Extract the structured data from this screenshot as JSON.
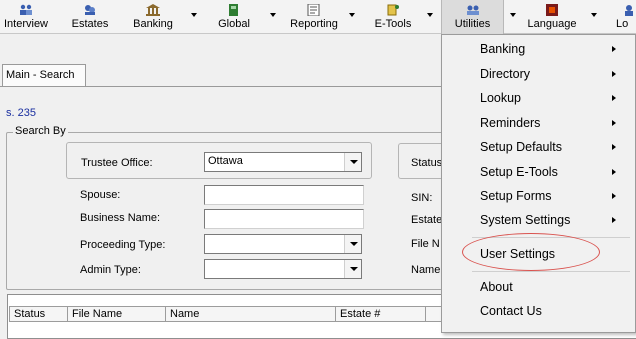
{
  "toolbar": {
    "items": [
      {
        "label": "Interview",
        "icon": "interview-icon"
      },
      {
        "label": "Estates",
        "icon": "estates-icon"
      },
      {
        "label": "Banking",
        "icon": "banking-icon"
      },
      {
        "label": "Global",
        "icon": "global-icon"
      },
      {
        "label": "Reporting",
        "icon": "reporting-icon"
      },
      {
        "label": "E-Tools",
        "icon": "e-tools-icon"
      },
      {
        "label": "Utilities",
        "icon": "utilities-icon"
      },
      {
        "label": "Language",
        "icon": "language-icon"
      },
      {
        "label": "Lo",
        "icon": "log-icon"
      }
    ]
  },
  "tab": {
    "label": "Main - Search"
  },
  "section_code": "s. 235",
  "search": {
    "group_title": "Search By",
    "trustee_office_label": "Trustee Office:",
    "trustee_office_value": "Ottawa",
    "status_label": "Status",
    "spouse_label": "Spouse:",
    "business_name_label": "Business Name:",
    "proceeding_type_label": "Proceeding Type:",
    "admin_type_label": "Admin Type:",
    "sin_label": "SIN:",
    "estate_label": "Estate",
    "file_label": "File N",
    "name_label": "Name"
  },
  "grid": {
    "columns": [
      "Status",
      "File Name",
      "Name",
      "Estate #",
      ""
    ]
  },
  "utilities_menu": {
    "items": [
      {
        "label": "Banking",
        "has_submenu": true
      },
      {
        "label": "Directory",
        "has_submenu": true
      },
      {
        "label": "Lookup",
        "has_submenu": true
      },
      {
        "label": "Reminders",
        "has_submenu": true
      },
      {
        "label": "Setup Defaults",
        "has_submenu": true
      },
      {
        "label": "Setup E-Tools",
        "has_submenu": true
      },
      {
        "label": "Setup Forms",
        "has_submenu": true
      },
      {
        "label": "System Settings",
        "has_submenu": true
      },
      {
        "label": "User Settings",
        "has_submenu": false,
        "highlighted": true
      },
      {
        "label": "About",
        "has_submenu": false
      },
      {
        "label": "Contact Us",
        "has_submenu": false
      }
    ]
  },
  "colors": {
    "highlight_ellipse": "#d9534f",
    "section_code": "#1a2fa0"
  }
}
